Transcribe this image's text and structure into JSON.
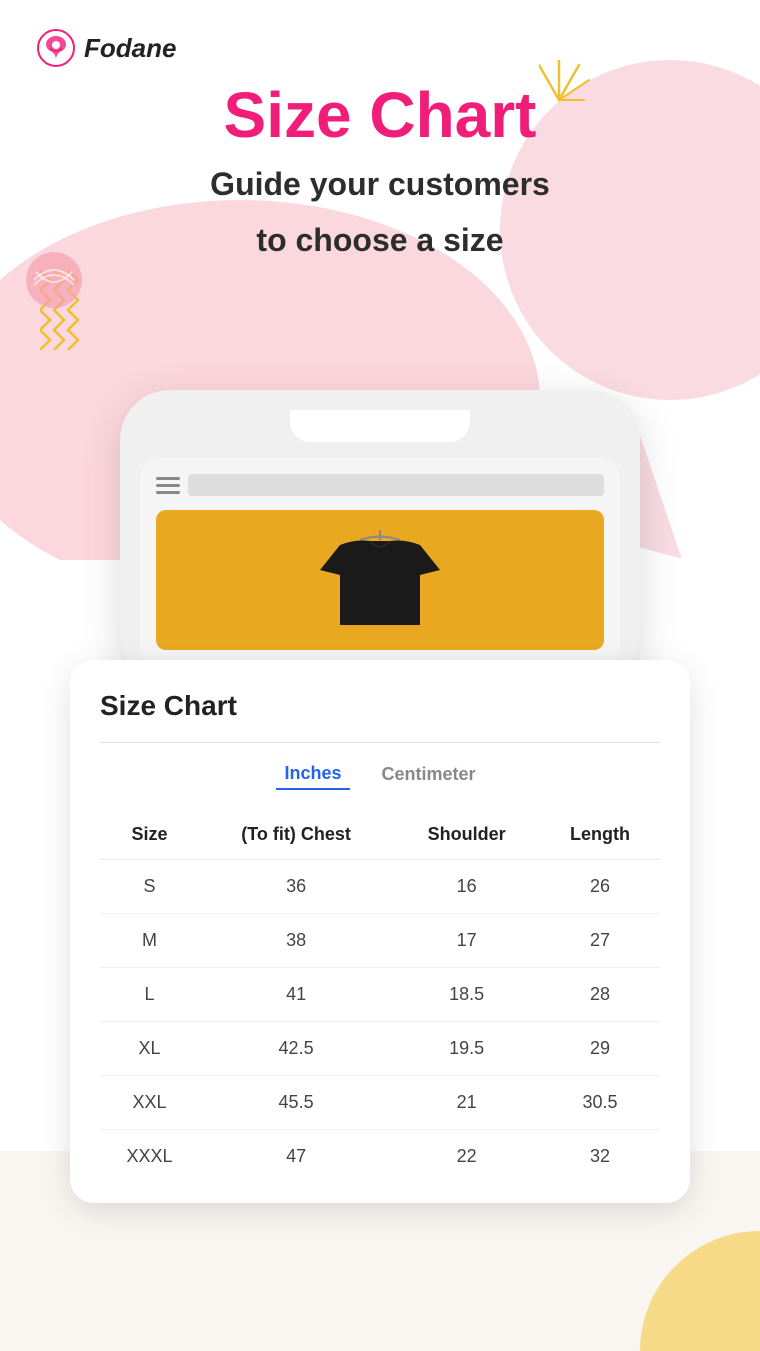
{
  "header": {
    "logo_text": "Fodane"
  },
  "hero": {
    "title": "Size Chart",
    "subtitle_line1": "Guide your customers",
    "subtitle_line2": "to choose a size"
  },
  "unit_toggle": {
    "inches_label": "Inches",
    "centimeter_label": "Centimeter"
  },
  "size_chart": {
    "title": "Size Chart",
    "columns": [
      "Size",
      "(To fit) Chest",
      "Shoulder",
      "Length"
    ],
    "rows": [
      [
        "S",
        "36",
        "16",
        "26"
      ],
      [
        "M",
        "38",
        "17",
        "27"
      ],
      [
        "L",
        "41",
        "18.5",
        "28"
      ],
      [
        "XL",
        "42.5",
        "19.5",
        "29"
      ],
      [
        "XXL",
        "45.5",
        "21",
        "30.5"
      ],
      [
        "XXXL",
        "47",
        "22",
        "32"
      ]
    ]
  },
  "icons": {
    "hamburger": "hamburger-menu-icon",
    "sparkle": "sparkle-icon",
    "logo_badge": "fodane-logo-icon"
  }
}
